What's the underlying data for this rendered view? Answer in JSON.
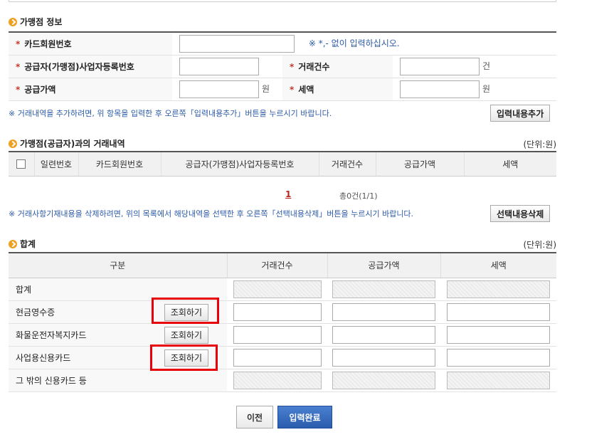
{
  "merchant": {
    "title": "가맹점 정보",
    "card_no_label": "카드회원번호",
    "card_no_value": "",
    "card_no_hint": "※ *,- 없이 입력하십시오.",
    "biz_no_label": "공급자(가맹점)사업자등록번호",
    "biz_no_value": "",
    "tx_count_label": "거래건수",
    "tx_count_value": "",
    "tx_count_unit": "건",
    "supply_label": "공급가액",
    "supply_value": "",
    "supply_unit": "원",
    "tax_label": "세액",
    "tax_value": "",
    "tax_unit": "원",
    "note": "※ 거래내역을 추가하려면, 위 항목을 입력한 후 오른쪽「입력내용추가」버튼을 누르시기 바랍니다.",
    "add_button": "입력내용추가"
  },
  "transactions": {
    "title": "가맹점(공급자)과의 거래내역",
    "unit": "(단위:원)",
    "columns": [
      "일련번호",
      "카드회원번호",
      "공급자(가맹점)사업자등록번호",
      "거래건수",
      "공급가액",
      "세액"
    ],
    "page": "1",
    "total": "총0건(1/1)",
    "note": "※ 거래사항기재내용을 삭제하려면, 위의 목록에서 해당내역을 선택한 후 오른쪽「선택내용삭제」버튼을 누르시기 바랍니다.",
    "delete_button": "선택내용삭제"
  },
  "summary": {
    "title": "합계",
    "unit": "(단위:원)",
    "columns": [
      "구분",
      "거래건수",
      "공급가액",
      "세액"
    ],
    "rows": [
      {
        "name": "합계",
        "lookup": ""
      },
      {
        "name": "현금영수증",
        "lookup": "조회하기"
      },
      {
        "name": "화물운전자복지카드",
        "lookup": "조회하기"
      },
      {
        "name": "사업용신용카드",
        "lookup": "조회하기"
      },
      {
        "name": "그 밖의 신용카드 등",
        "lookup": ""
      }
    ]
  },
  "actions": {
    "prev": "이전",
    "done": "입력완료"
  },
  "colors": {
    "highlight": "#e8000b",
    "primary_button": "#2a5cad",
    "note_text": "#2b5aa6"
  }
}
